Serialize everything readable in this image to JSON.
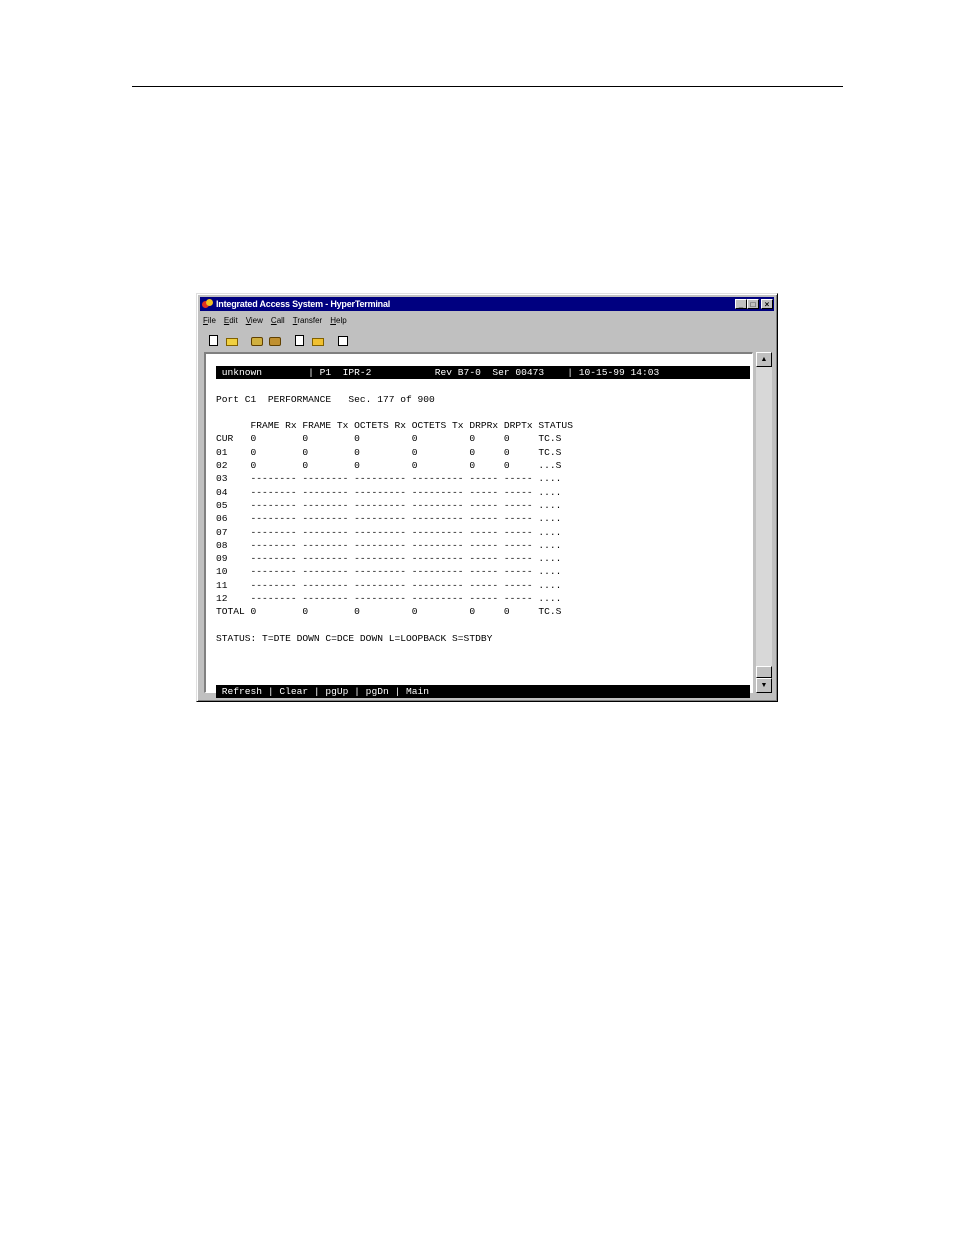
{
  "window": {
    "title": "Integrated Access System - HyperTerminal",
    "controls": {
      "minimize": "_",
      "maximize": "□",
      "close": "×"
    }
  },
  "menu": {
    "items": [
      {
        "key": "F",
        "rest": "ile"
      },
      {
        "key": "E",
        "rest": "dit"
      },
      {
        "key": "V",
        "rest": "iew"
      },
      {
        "key": "C",
        "rest": "all"
      },
      {
        "key": "T",
        "rest": "ransfer"
      },
      {
        "key": "H",
        "rest": "elp"
      }
    ]
  },
  "toolbar": {
    "icons": [
      "new-icon",
      "open-icon",
      "connect-icon",
      "disconnect-icon",
      "send-icon",
      "receive-icon",
      "properties-icon"
    ]
  },
  "terminal": {
    "header": " unknown        | P1  IPR-2           Rev B7-0  Ser 00473    | 10-15-99 14:03",
    "title_line": "Port C1  PERFORMANCE   Sec. 177 of 900",
    "column_header": "      FRAME Rx FRAME Tx OCTETS Rx OCTETS Tx DRPRx DRPTx STATUS",
    "rows": [
      "CUR   0        0        0         0         0     0     TC.S",
      "01    0        0        0         0         0     0     TC.S",
      "02    0        0        0         0         0     0     ...S",
      "03    -------- -------- --------- --------- ----- ----- ....",
      "04    -------- -------- --------- --------- ----- ----- ....",
      "05    -------- -------- --------- --------- ----- ----- ....",
      "06    -------- -------- --------- --------- ----- ----- ....",
      "07    -------- -------- --------- --------- ----- ----- ....",
      "08    -------- -------- --------- --------- ----- ----- ....",
      "09    -------- -------- --------- --------- ----- ----- ....",
      "10    -------- -------- --------- --------- ----- ----- ....",
      "11    -------- -------- --------- --------- ----- ----- ....",
      "12    -------- -------- --------- --------- ----- ----- ....",
      "TOTAL 0        0        0         0         0     0     TC.S"
    ],
    "status_legend": "STATUS: T=DTE DOWN C=DCE DOWN L=LOOPBACK S=STDBY",
    "footer": " Refresh | Clear | pgUp | pgDn | Main"
  },
  "scrollbar": {
    "up": "▲",
    "down": "▼"
  }
}
